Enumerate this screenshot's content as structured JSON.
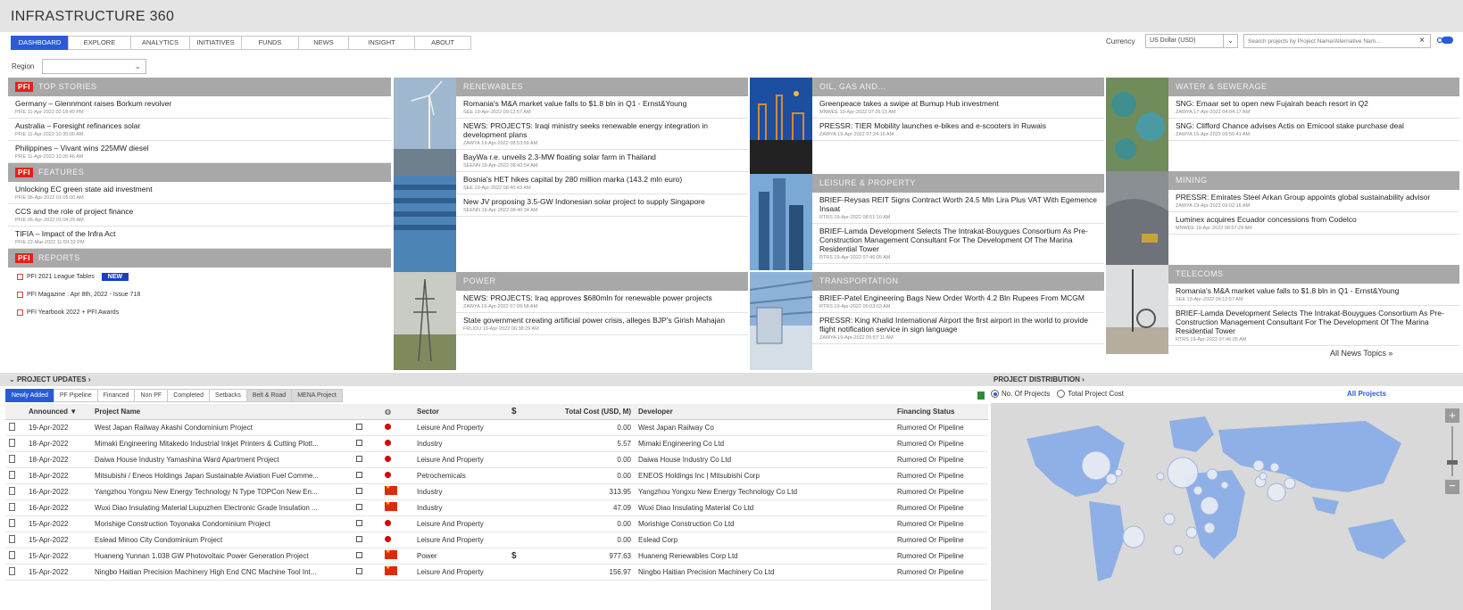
{
  "app": {
    "title": "INFRASTRUCTURE 360"
  },
  "nav": {
    "tabs": [
      {
        "label": "DASHBOARD",
        "active": true
      },
      {
        "label": "EXPLORE"
      },
      {
        "label": "ANALYTICS"
      },
      {
        "label": "INITIATIVES"
      },
      {
        "label": "FUNDS"
      },
      {
        "label": "NEWS"
      },
      {
        "label": "INSIGHT"
      },
      {
        "label": "ABOUT"
      }
    ]
  },
  "currency": {
    "label": "Currency",
    "value": "US Dollar (USD)"
  },
  "search": {
    "placeholder": "Search projects by Project Name/Alternative Nam..."
  },
  "region": {
    "label": "Region",
    "value": ""
  },
  "pfi": {
    "badge": "PFI",
    "top_stories": {
      "title": "TOP STORIES",
      "items": [
        {
          "headline": "Germany – Glennmont raises Borkum revolver",
          "meta": "PFIE 11-Apr-2022 02:18:49 PM"
        },
        {
          "headline": "Australia – Foresight refinances solar",
          "meta": "PFIE 11-Apr-2022 10:30:00 AM"
        },
        {
          "headline": "Philippines – Vivant wins 225MW diesel",
          "meta": "PFIE 11-Apr-2022 10:26:46 AM"
        }
      ]
    },
    "features": {
      "title": "FEATURES",
      "items": [
        {
          "headline": "Unlocking EC green state aid investment",
          "meta": "PFIE 06-Apr-2022 01:05:00 AM"
        },
        {
          "headline": "CCS and the role of project finance",
          "meta": "PFIE 06-Apr-2022 01:04:25 AM"
        },
        {
          "headline": "TIFIA – Impact of the Infra Act",
          "meta": "PFIE 22-Mar-2022 11:59:32 PM"
        }
      ]
    },
    "reports": {
      "title": "REPORTS",
      "items": [
        {
          "label": "PFI 2021 League Tables",
          "badge": "NEW"
        },
        {
          "label": "PFI Magazine : Apr 8th, 2022 - Issue 718"
        },
        {
          "label": "PFI Yearbook 2022 + PFI Awards"
        }
      ]
    }
  },
  "topics": {
    "renewables": {
      "title": "RENEWABLES",
      "items": [
        {
          "headline": "Romania's M&A market value falls to $1.8 bln in Q1 - Ernst&Young",
          "meta": "SEE 19-Apr-2022 09:12:57 AM"
        },
        {
          "headline": "NEWS: PROJECTS: Iraqi ministry seeks renewable energy integration in development plans",
          "meta": "ZAWYA 19-Apr-2022 08:53:09 AM"
        },
        {
          "headline": "BayWa r.e. unveils 2.3-MW floating solar farm in Thailand",
          "meta": "SEENN 19-Apr-2022 08:43:54 AM"
        },
        {
          "headline": "Bosnia's HET hikes capital by 280 million marka (143.2 mln euro)",
          "meta": "SEE 19-Apr-2022 08:40:43 AM"
        },
        {
          "headline": "New JV proposing 3.5-GW Indonesian solar project to supply Singapore",
          "meta": "SEENN 19-Apr-2022 08:40:34 AM"
        }
      ]
    },
    "power": {
      "title": "POWER",
      "items": [
        {
          "headline": "NEWS: PROJECTS: Iraq approves $680mln for renewable power projects",
          "meta": "ZAWYA 19-Apr-2022 07:09:58 AM"
        },
        {
          "headline": "State government creating artificial power crisis, alleges BJP's Girish Mahajan",
          "meta": "FRLIOU 19-Apr-2022 06:38:29 AM"
        }
      ]
    },
    "oil_gas": {
      "title": "OIL, GAS AND...",
      "items": [
        {
          "headline": "Greenpeace takes a swipe at Bumup Hub investment",
          "meta": "MNWEE 19-Apr-2022 07:26:15 AM"
        },
        {
          "headline": "PRESSR: TIER Mobility launches e-bikes and e-scooters in Ruwais",
          "meta": "ZAWYA 19-Apr-2022 07:24:16 AM"
        }
      ]
    },
    "leisure": {
      "title": "LEISURE & PROPERTY",
      "items": [
        {
          "headline": "BRIEF-Reysas REIT Signs Contract Worth 24.5 Mln Lira Plus VAT With Egemence Insaat",
          "meta": "RTRS 19-Apr-2022 08:51:16 AM"
        },
        {
          "headline": "BRIEF-Lamda Development Selects The Intrakat-Bouygues Consortium As Pre-Construction Management Consultant For The Development Of The Marina Residential Tower",
          "meta": "RTRS 19-Apr-2022 07:46:05 AM"
        }
      ]
    },
    "transportation": {
      "title": "TRANSPORTATION",
      "items": [
        {
          "headline": "BRIEF-Patel Engineering Bags New Order Worth 4.2 Bln Rupees From MCGM",
          "meta": "RTRS 19-Apr-2022 06:03:03 AM"
        },
        {
          "headline": "PRESSR: King Khalid International Airport the first airport in the world to provide flight notification service in sign language",
          "meta": "ZAWYA 19-Apr-2022 05:57:11 AM"
        }
      ]
    },
    "water": {
      "title": "WATER & SEWERAGE",
      "items": [
        {
          "headline": "SNG: Emaar set to open new Fujairah beach resort in Q2",
          "meta": "ZAWYA 17-Apr-2022 04:04:17 AM"
        },
        {
          "headline": "SNG: Clifford Chance advises Actis on Emicool stake purchase deal",
          "meta": "ZAWYA 15-Apr-2022 09:50:41 AM"
        }
      ]
    },
    "mining": {
      "title": "MINING",
      "items": [
        {
          "headline": "PRESSR: Emirates Steel Arkan Group appoints global sustainability advisor",
          "meta": "ZAWYA 19-Apr-2022 09:02:16 AM"
        },
        {
          "headline": "Luminex acquires Ecuador concessions from Codelco",
          "meta": "MNWEE 19-Apr-2022 08:57:29 AM"
        }
      ]
    },
    "telecoms": {
      "title": "TELECOMS",
      "items": [
        {
          "headline": "Romania's M&A market value falls to $1.8 bln in Q1 - Ernst&Young",
          "meta": "SEE 19-Apr-2022 09:12:57 AM"
        },
        {
          "headline": "BRIEF-Lamda Development Selects The Intrakat-Bouygues Consortium As Pre-Construction Management Consultant For The Development Of The Marina Residential Tower",
          "meta": "RTRS 19-Apr-2022 07:46:05 AM"
        }
      ]
    },
    "all_news_link": "All News Topics"
  },
  "project_updates": {
    "title": "PROJECT UPDATES",
    "tabs": [
      {
        "label": "Newly Added",
        "active": true
      },
      {
        "label": "PF Pipeline"
      },
      {
        "label": "Financed"
      },
      {
        "label": "Non PF"
      },
      {
        "label": "Completed"
      },
      {
        "label": "Setbacks"
      },
      {
        "label": "Belt & Road",
        "grey": true
      },
      {
        "label": "MENA Project",
        "grey": true
      }
    ],
    "columns": {
      "announced": "Announced",
      "project_name": "Project Name",
      "sector": "Sector",
      "total_cost": "Total Cost (USD, M)",
      "developer": "Developer",
      "financing_status": "Financing Status"
    },
    "rows": [
      {
        "date": "19-Apr-2022",
        "name": "West Japan Railway Akashi Condominium Project",
        "flag": "dot",
        "sector": "Leisure And Property",
        "usd": false,
        "cost": "0.00",
        "developer": "West Japan Railway Co",
        "status": "Rumored Or Pipeline"
      },
      {
        "date": "18-Apr-2022",
        "name": "Mimaki Engineering Mitakedo Industrial Inkjet Printers & Cutting Plott...",
        "flag": "dot",
        "sector": "Industry",
        "usd": false,
        "cost": "5.57",
        "developer": "Mimaki Engineering Co Ltd",
        "status": "Rumored Or Pipeline"
      },
      {
        "date": "18-Apr-2022",
        "name": "Daiwa House Industry Yamashina Ward Apartment Project",
        "flag": "dot",
        "sector": "Leisure And Property",
        "usd": false,
        "cost": "0.00",
        "developer": "Daiwa House Industry Co Ltd",
        "status": "Rumored Or Pipeline"
      },
      {
        "date": "18-Apr-2022",
        "name": "Mitsubishi / Eneos Holdings Japan Sustainable Aviation Fuel Comme...",
        "flag": "dot",
        "sector": "Petrochemicals",
        "usd": false,
        "cost": "0.00",
        "developer": "ENEOS Holdings Inc | Mitsubishi Corp",
        "status": "Rumored Or Pipeline"
      },
      {
        "date": "16-Apr-2022",
        "name": "Yangzhou Yongxu New Energy Technology N Type TOPCon New En...",
        "flag": "cn",
        "sector": "Industry",
        "usd": false,
        "cost": "313.95",
        "developer": "Yangzhou Yongxu New Energy Technology Co Ltd",
        "status": "Rumored Or Pipeline"
      },
      {
        "date": "16-Apr-2022",
        "name": "Wuxi Diao Insulating Material Liupuzhen Electronic Grade Insulation ...",
        "flag": "cn",
        "sector": "Industry",
        "usd": false,
        "cost": "47.09",
        "developer": "Wuxi Diao Insulating Material Co Ltd",
        "status": "Rumored Or Pipeline"
      },
      {
        "date": "15-Apr-2022",
        "name": "Morishige Construction Toyonaka Condominium Project",
        "flag": "dot",
        "sector": "Leisure And Property",
        "usd": false,
        "cost": "0.00",
        "developer": "Morishige Construction Co Ltd",
        "status": "Rumored Or Pipeline"
      },
      {
        "date": "15-Apr-2022",
        "name": "Eslead Minoo City Condominium Project",
        "flag": "dot",
        "sector": "Leisure And Property",
        "usd": false,
        "cost": "0.00",
        "developer": "Eslead Corp",
        "status": "Rumored Or Pipeline"
      },
      {
        "date": "15-Apr-2022",
        "name": "Huaneng Yunnan 1.038 GW Photovoltaic Power Generation Project",
        "flag": "cn",
        "sector": "Power",
        "usd": true,
        "cost": "977.63",
        "developer": "Huaneng Renewables Corp Ltd",
        "status": "Rumored Or Pipeline"
      },
      {
        "date": "15-Apr-2022",
        "name": "Ningbo Haitian Precision Machinery High End CNC Machine Tool Int...",
        "flag": "cn",
        "sector": "Leisure And Property",
        "usd": false,
        "cost": "156.97",
        "developer": "Ningbo Haitian Precision Machinery Co Ltd",
        "status": "Rumored Or Pipeline"
      }
    ]
  },
  "project_distribution": {
    "title": "PROJECT DISTRIBUTION",
    "options": [
      {
        "label": "No. Of Projects",
        "selected": true
      },
      {
        "label": "Total Project Cost",
        "selected": false
      }
    ],
    "all_projects_link": "All Projects"
  },
  "colors": {
    "accent": "#2a5bd7",
    "pfi_red": "#e2231a",
    "header_grey": "#a8a8a8"
  }
}
